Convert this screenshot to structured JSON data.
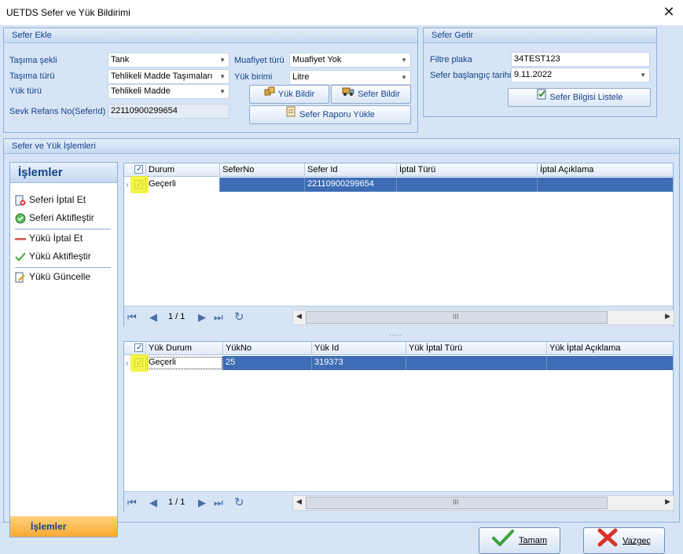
{
  "window": {
    "title": "UETDS Sefer ve Yük Bildirimi",
    "close_glyph": "✕"
  },
  "sefer_ekle": {
    "title": "Sefer Ekle",
    "tasima_sekli_label": "Taşıma şekli",
    "tasima_sekli_value": "Tank",
    "tasima_turu_label": "Taşıma türü",
    "tasima_turu_value": "Tehlikeli Madde Taşımaları",
    "yuk_turu_label": "Yük türü",
    "yuk_turu_value": "Tehlikeli Madde",
    "sevk_label": "Sevk Refans No(SeferId)",
    "sevk_value": "22110900299654",
    "muafiyet_label": "Muafiyet türü",
    "muafiyet_value": "Muafiyet Yok",
    "yuk_birimi_label": "Yük birimi",
    "yuk_birimi_value": "Litre",
    "yuk_bildir": "Yük Bildir",
    "sefer_bildir": "Sefer Bildir",
    "sefer_raporu": "Sefer Raporu Yükle"
  },
  "sefer_getir": {
    "title": "Sefer Getir",
    "filtre_label": "Filtre plaka",
    "filtre_value": "34TEST123",
    "tarih_label": "Sefer başlangıç tarihi",
    "tarih_value": "9.11.2022",
    "listele": "Sefer Bilgisi Listele"
  },
  "islemler_group": {
    "title": "Sefer ve Yük İşlemleri"
  },
  "nav": {
    "header": "İşlemler",
    "items": [
      "Seferi İptal Et",
      "Seferi Aktifleştir",
      "Yükü İptal Et",
      "Yükü Aktifleştir",
      "Yükü Güncelle"
    ],
    "footer": "İşlemler"
  },
  "sefer_grid": {
    "columns": [
      "Durum",
      "SeferNo",
      "Sefer Id",
      "İptal Türü",
      "İptal Açıklama"
    ],
    "rows": [
      {
        "durum": "Geçerli",
        "sefer_no": "",
        "sefer_id": "22110900299654",
        "iptal_turu": "",
        "iptal_aciklama": ""
      }
    ],
    "page": "1 / 1"
  },
  "yuk_grid": {
    "columns": [
      "Yük Durum",
      "YükNo",
      "Yük Id",
      "Yük İptal Türü",
      "Yük İptal Açıklama"
    ],
    "rows": [
      {
        "durum": "Geçerli",
        "yuk_no": "25",
        "yuk_id": "319373",
        "iptal_turu": "",
        "iptal_aciklama": ""
      }
    ],
    "page": "1 / 1"
  },
  "splitter": ".....",
  "scroll_thumb_glyph": "III",
  "footer": {
    "tamam": "Tamam",
    "vazgec": "Vazgeç"
  },
  "colors": {
    "accent": "#15428b",
    "selection": "#3e6db5",
    "highlight": "#f2f20a",
    "nav_footer": "#f7a933"
  }
}
